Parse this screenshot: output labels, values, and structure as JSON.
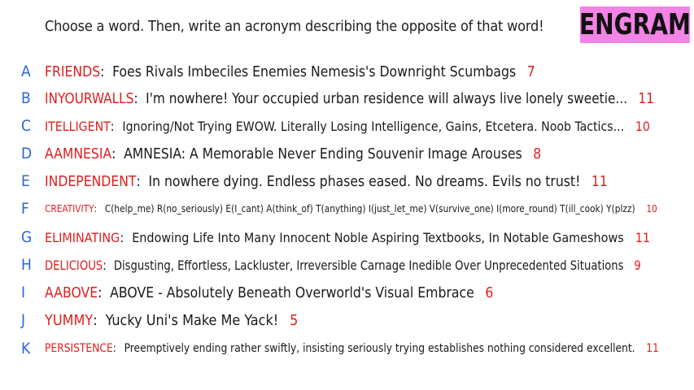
{
  "prompt": "Choose a word. Then, write an acronym describing the opposite of that word!",
  "logo": "ENGRAM",
  "colors": {
    "letter": "#2a66d8",
    "word": "#e11d1d",
    "score": "#e11d1d",
    "logo_bg": "#f483e6"
  },
  "entries": [
    {
      "letter": "A",
      "word": "FRIENDS",
      "text": "Foes Rivals Imbeciles Enemies Nemesis's Downright Scumbags",
      "score": "7"
    },
    {
      "letter": "B",
      "word": "INYOURWALLS",
      "text": "I'm nowhere! Your occupied urban residence will always live lonely sweetie...",
      "score": "11"
    },
    {
      "letter": "C",
      "word": "ITELLIGENT",
      "text": "Ignoring/Not Trying EWOW. Literally Losing Intelligence, Gains, Etcetera. Noob Tactics...",
      "score": "10"
    },
    {
      "letter": "D",
      "word": "AAMNESIA",
      "text": "AMNESIA: A Memorable Never Ending Souvenir Image Arouses",
      "score": "8"
    },
    {
      "letter": "E",
      "word": "INDEPENDENT",
      "text": "In nowhere dying. Endless phases eased. No dreams. Evils no trust!",
      "score": "11"
    },
    {
      "letter": "F",
      "word": "CREATIVITY",
      "text": "C(help_me) R(no_seriously) E(I_cant) A(think_of) T(anything) I(just_let_me) V(survive_one) I(more_round) T(ill_cook) Y(plzz)",
      "score": "10"
    },
    {
      "letter": "G",
      "word": "ELIMINATING",
      "text": "Endowing Life Into Many Innocent Noble Aspiring Textbooks, In Notable Gameshows",
      "score": "11"
    },
    {
      "letter": "H",
      "word": "DELICIOUS",
      "text": "Disgusting, Effortless, Lackluster, Irreversible Carnage Inedible Over Unprecedented Situations",
      "score": "9"
    },
    {
      "letter": "I",
      "word": "AABOVE",
      "text": "ABOVE - Absolutely Beneath Overworld's Visual Embrace",
      "score": "6"
    },
    {
      "letter": "J",
      "word": "YUMMY",
      "text": "Yucky Uni's Make Me Yack!",
      "score": "5"
    },
    {
      "letter": "K",
      "word": "PERSISTENCE",
      "text": "Preemptively ending rather swiftly, insisting seriously trying establishes nothing considered excellent.",
      "score": "11"
    }
  ]
}
